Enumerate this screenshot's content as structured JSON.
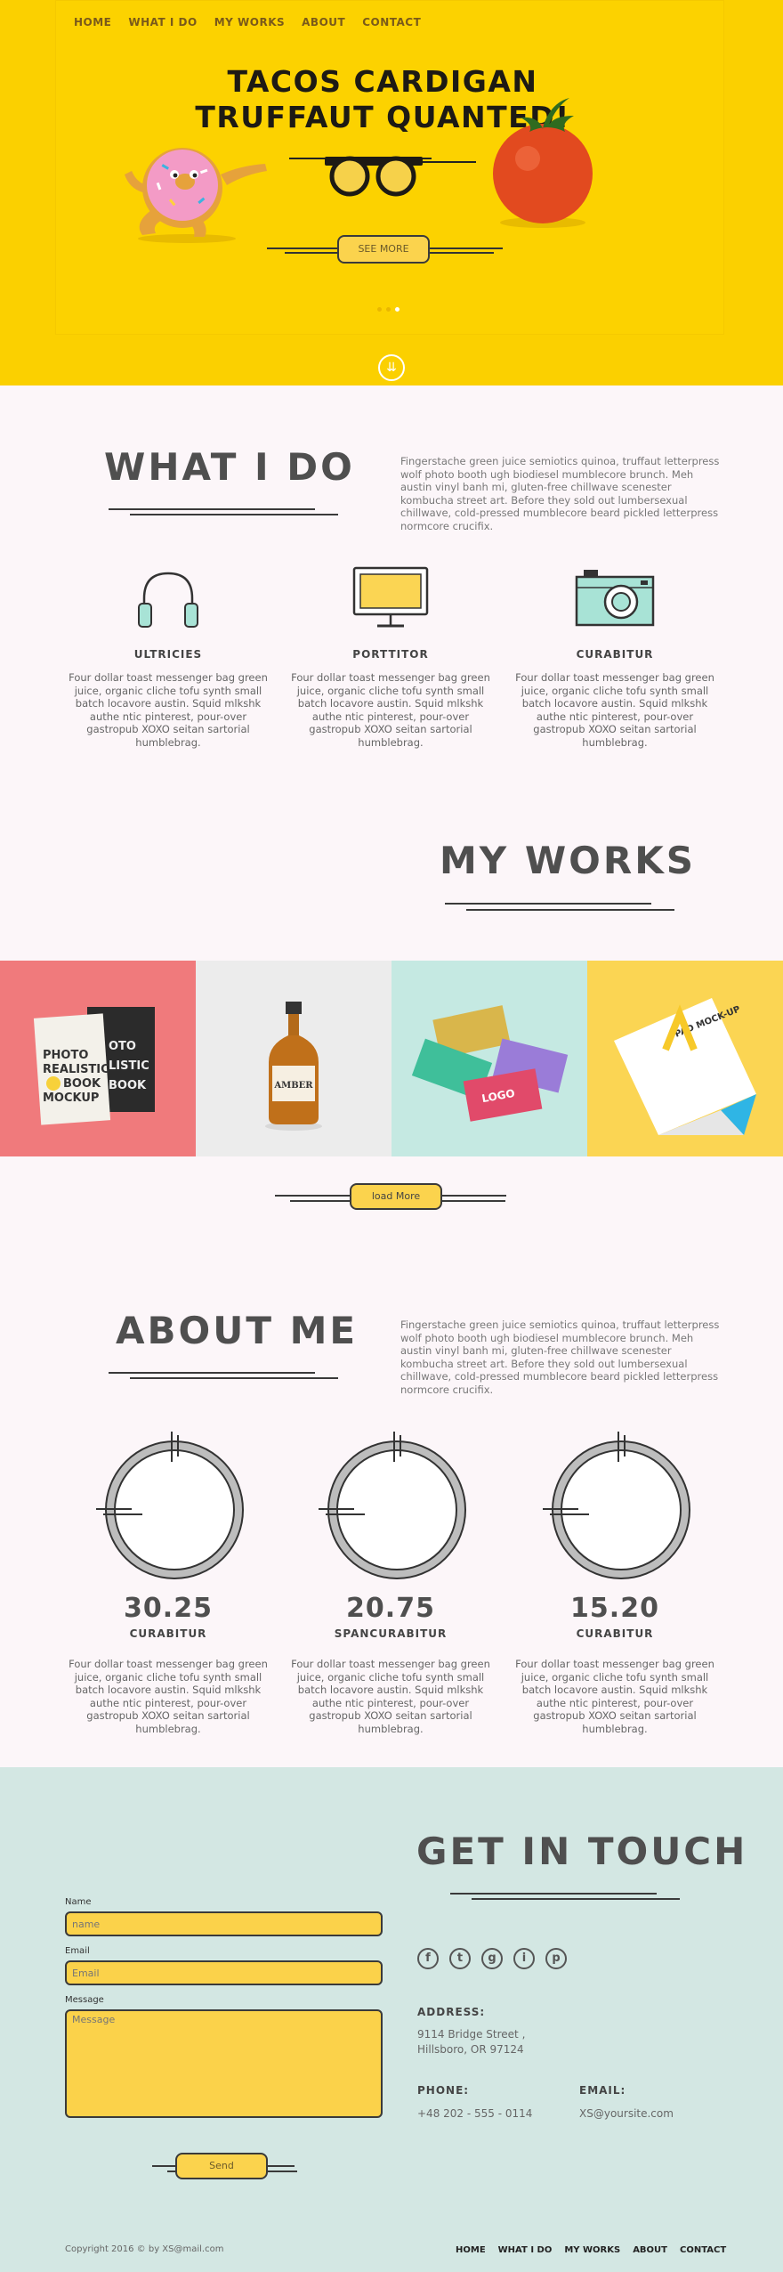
{
  "nav": [
    "HOME",
    "WHAT I DO",
    "MY WORKS",
    "ABOUT",
    "CONTACT"
  ],
  "hero": {
    "title_line1": "TACOS CARDIGAN",
    "title_line2": "TRUFFAUT QUANTED!",
    "button": "SEE MORE",
    "slide_counter": "1 / 3"
  },
  "what_i_do": {
    "title": "WHAT I DO",
    "intro": "Fingerstache green juice semiotics quinoa, truffaut letterpress wolf photo booth ugh biodiesel mumblecore brunch. Meh austin vinyl banh mi, gluten-free chillwave scenester kombucha street art. Before they sold out lumbersexual chillwave, cold-pressed mumblecore beard pickled letterpress normcore crucifix.",
    "features": [
      {
        "icon": "headphones-icon",
        "title": "ULTRICIES",
        "text": "Four dollar toast messenger bag green juice, organic cliche tofu synth small batch locavore austin. Squid mlkshk authe ntic pinterest, pour-over gastropub XOXO seitan sartorial humblebrag."
      },
      {
        "icon": "monitor-icon",
        "title": "PORTTITOR",
        "text": "Four dollar toast messenger bag green juice, organic cliche tofu synth small batch locavore austin. Squid mlkshk authe ntic pinterest, pour-over gastropub XOXO seitan sartorial humblebrag."
      },
      {
        "icon": "camera-icon",
        "title": "CURABITUR",
        "text": "Four dollar toast messenger bag green juice, organic cliche tofu synth small batch locavore austin. Squid mlkshk authe ntic pinterest, pour-over gastropub XOXO seitan sartorial humblebrag."
      }
    ]
  },
  "my_works": {
    "title": "MY WORKS",
    "items": [
      {
        "name": "book-mockup",
        "color": "#f07a7c",
        "label_lines": [
          "PHOTO",
          "REALISTIC",
          "BOOK",
          "MOCKUP"
        ]
      },
      {
        "name": "amber-bottle",
        "color": "#ececec",
        "label": "AMBER"
      },
      {
        "name": "business-cards",
        "color": "#c5e9e2",
        "label": "LOGO"
      },
      {
        "name": "pad-mockup",
        "color": "#fbd553",
        "label": "PAD MOCK-UP"
      }
    ],
    "load_more": "load More"
  },
  "about_me": {
    "title": "ABOUT ME",
    "intro": "Fingerstache green juice semiotics quinoa, truffaut letterpress wolf photo booth ugh biodiesel mumblecore brunch. Meh austin vinyl banh mi, gluten-free chillwave scenester kombucha street art. Before they sold out lumbersexual chillwave, cold-pressed mumblecore beard pickled letterpress normcore crucifix.",
    "stats": [
      {
        "value": "30.25",
        "label": "CURABITUR",
        "text": "Four dollar toast messenger bag green juice, organic cliche tofu synth small batch locavore austin. Squid mlkshk authe ntic pinterest, pour-over gastropub XOXO seitan sartorial humblebrag."
      },
      {
        "value": "20.75",
        "label": "SPANCURABITUR",
        "text": "Four dollar toast messenger bag green juice, organic cliche tofu synth small batch locavore austin. Squid mlkshk authe ntic pinterest, pour-over gastropub XOXO seitan sartorial humblebrag."
      },
      {
        "value": "15.20",
        "label": "CURABITUR",
        "text": "Four dollar toast messenger bag green juice, organic cliche tofu synth small batch locavore austin. Squid mlkshk authe ntic pinterest, pour-over gastropub XOXO seitan sartorial humblebrag."
      }
    ]
  },
  "contact": {
    "title": "GET IN TOUCH",
    "name_label": "Name",
    "name_placeholder": "name",
    "email_label": "Email",
    "email_placeholder": "Email",
    "message_label": "Message",
    "message_placeholder": "Message",
    "send": "Send",
    "social": [
      "f",
      "t",
      "g",
      "i",
      "p"
    ],
    "address_head": "ADDRESS:",
    "address_line1": "9114 Bridge Street ,",
    "address_line2": "Hillsboro, OR 97124",
    "phone_head": "PHONE:",
    "phone": "+48 202 - 555 - 0114",
    "email_head": "EMAIL:",
    "email": "XS@yoursite.com"
  },
  "footer": {
    "copyright": "Copyright 2016 © by XS@mail.com",
    "nav": [
      "HOME",
      "WHAT I DO",
      "MY WORKS",
      "ABOUT",
      "CONTACT"
    ]
  },
  "colors": {
    "hero_yellow": "#fbd000",
    "button_yellow": "#fbd34d",
    "contact_bg": "#d3e7e3",
    "page_bg": "#fcf6f9",
    "heading": "#4f4f4f"
  }
}
